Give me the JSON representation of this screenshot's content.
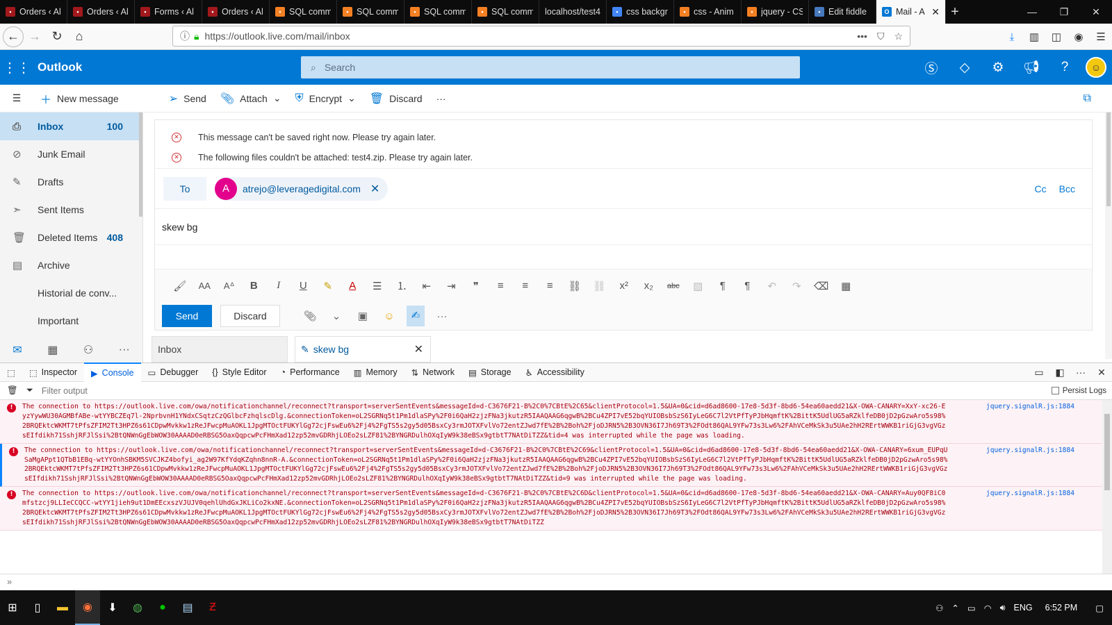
{
  "browser": {
    "tabs": [
      {
        "label": "Orders ‹ Al",
        "icon": "wp-icon",
        "color": "#a1191c"
      },
      {
        "label": "Orders ‹ Al",
        "icon": "wp-icon",
        "color": "#a1191c"
      },
      {
        "label": "Forms ‹ Al",
        "icon": "wp-icon",
        "color": "#a1191c"
      },
      {
        "label": "Orders ‹ Al",
        "icon": "wp-icon",
        "color": "#a1191c"
      },
      {
        "label": "SQL comm",
        "icon": "so-icon",
        "color": "#f48024"
      },
      {
        "label": "SQL comm",
        "icon": "so-icon",
        "color": "#f48024"
      },
      {
        "label": "SQL comm",
        "icon": "so-icon",
        "color": "#f48024"
      },
      {
        "label": "SQL comm",
        "icon": "so-icon",
        "color": "#f48024"
      },
      {
        "label": "localhost/test4",
        "icon": "",
        "color": ""
      },
      {
        "label": "css backgr",
        "icon": "google-icon",
        "color": "#4285f4"
      },
      {
        "label": "css - Anim",
        "icon": "so-icon",
        "color": "#f48024"
      },
      {
        "label": "jquery - CS",
        "icon": "so-icon",
        "color": "#f48024"
      },
      {
        "label": "Edit fiddle",
        "icon": "jsfiddle-icon",
        "color": "#4679bd"
      }
    ],
    "active_tab": {
      "label": "Mail - A",
      "icon": "outlook-icon",
      "color": "#0078d4"
    },
    "url": "https://outlook.live.com/mail/inbox"
  },
  "outlook": {
    "brand": "Outlook",
    "search_placeholder": "Search",
    "commands": {
      "new_message": "New message",
      "send": "Send",
      "attach": "Attach",
      "encrypt": "Encrypt",
      "discard": "Discard"
    },
    "folders": [
      {
        "label": "Inbox",
        "count": "100",
        "icon": "inbox-icon"
      },
      {
        "label": "Junk Email",
        "count": "",
        "icon": "junk-icon"
      },
      {
        "label": "Drafts",
        "count": "",
        "icon": "pencil-icon"
      },
      {
        "label": "Sent Items",
        "count": "",
        "icon": "sent-icon"
      },
      {
        "label": "Deleted Items",
        "count": "408",
        "icon": "trash-icon"
      },
      {
        "label": "Archive",
        "count": "",
        "icon": "archive-icon"
      },
      {
        "label": "Historial de conv...",
        "count": "",
        "icon": ""
      },
      {
        "label": "Important",
        "count": "",
        "icon": ""
      }
    ],
    "compose": {
      "errors": [
        "This message can't be saved right now. Please try again later.",
        "The following files couldn't be attached: test4.zip. Please try again later."
      ],
      "to_label": "To",
      "recipient_initial": "A",
      "recipient": "atrejo@leveragedigital.com",
      "cc": "Cc",
      "bcc": "Bcc",
      "subject": "skew bg",
      "send": "Send",
      "discard": "Discard"
    },
    "bottom_tabs": {
      "inbox": "Inbox",
      "draft": "skew bg"
    },
    "accent": "#0078d4"
  },
  "devtools": {
    "tabs": [
      "Inspector",
      "Console",
      "Debugger",
      "Style Editor",
      "Performance",
      "Memory",
      "Network",
      "Storage",
      "Accessibility"
    ],
    "active_tab": "Console",
    "filter_placeholder": "Filter output",
    "persist_logs": "Persist Logs",
    "messages": [
      {
        "text": "The connection to https://outlook.live.com/owa/notificationchannel/reconnect?transport=serverSentEvents&messageId=d-C3676F21-B%2C0%7CBtE%2C65&clientProtocol=1.5&UA=0&cid=d6ad8600-17e8-5d3f-8bd6-54ea60aedd21&X-OWA-CANARY=XxY-xc26-EyzYywWU30AGMBfABe-wtYYBCZEq7l-2NprbvnH1YNdxCSqtzCzQGlbcFzhqlscDlg.&connectionToken=oL2SGRNq5t1Pm1dlaSPy%2F0i6QaH2zjzFNa3jkutzR5IAAQAAG6qgwB%2BCu4ZPI7vE52bqYUIOBsbSzS6IyLeG6C7l2VtPfTyPJbHqmftK%2BittK5UdlUG5aRZklfeDB0jD2pGzwAro5s98%2BRQEktcWKMT7tPfsZFIM2Tt3HPZ6s61CDpwMvkkw1zReJFwcpMuAOKL1JpgMTOctFUKYlGg72cjFswEu6%2Fj4%2FgTS5s2gy5d05BsxCy3rmJOTXFvlVo72entZJwd7fE%2B%2Boh%2FjoDJRN5%2B3OVN36I7Jh69T3%2FOdt86QAL9YFw73s3Lw6%2FAhVCeMkSk3u5UAe2hH2RErtWWKB1riGjG3vgVGzsEIfdikh71SshjRFJlSsi%2BtQNWnGgEbWOW30AAAAD0eRBSG5OaxQqpcwPcFHmXad12zp52mvGDRhjLOEo2sLZF81%2BYNGRDulhOXqIyW9k38eBSx9gtbtT7NAtDiTZZ&tid=4 was interrupted while the page was loading.",
        "source": "jquery.signalR.js:1884"
      },
      {
        "text": "The connection to https://outlook.live.com/owa/notificationchannel/reconnect?transport=serverSentEvents&messageId=d-C3676F21-B%2C0%7CBtE%2C69&clientProtocol=1.5&UA=0&cid=d6ad8600-17e8-5d3f-8bd6-54ea60aedd21&X-OWA-CANARY=6xum_EUPqUSaMgAPpt1QTbB1EBq-wtYYOnhSBKM5SVCJKZ4bofyi_ag2W97KfYdqKZqhn8nnR-A.&connectionToken=oL2SGRNq5t1Pm1dlaSPy%2F0i6QaH2zjzFNa3jkutzR5IAAQAAG6qgwB%2BCu4ZPI7vE52bqYUIOBsbSzS6IyLeG6C7l2VtPfTyPJbHqmftK%2BittK5UdlUG5aRZklfeDB0jD2pGzwAro5s98%2BRQEktcWKMT7tPfsZFIM2Tt3HPZ6s61CDpwMvkkw1zReJFwcpMuAOKL1JpgMTOctFUKYlGg72cjFswEu6%2Fj4%2FgTS5s2gy5d05BsxCy3rmJOTXFvlVo72entZJwd7fE%2B%2Boh%2FjoDJRN5%2B3OVN36I7Jh69T3%2FOdt86QAL9YFw73s3Lw6%2FAhVCeMkSk3u5UAe2hH2RErtWWKB1riGjG3vgVGzsEIfdikh71SshjRFJlSsi%2BtQNWnGgEbWOW30AAAAD0eRBSG5OaxQqpcwPcFHmXad12zp52mvGDRhjLOEo2sLZF81%2BYNGRDulhOXqIyW9k38eBSx9gtbtT7NAtDiTZZ&tid=9 was interrupted while the page was loading.",
        "source": "jquery.signalR.js:1884"
      },
      {
        "text": "The connection to https://outlook.live.com/owa/notificationchannel/reconnect?transport=serverSentEvents&messageId=d-C3676F21-B%2C0%7CBtE%2C6D&clientProtocol=1.5&UA=0&cid=d6ad8600-17e8-5d3f-8bd6-54ea60aedd21&X-OWA-CANARY=Auy0QF8iC0mfstzcj9LLIeCCQCC-wtYY1jieh9ut1DmEEcxszVJUJV0qehlUhdGxJKLiCo2kxNE.&connectionToken=oL2SGRNq5t1Pm1dlaSPy%2F0i6QaH2zjzFNa3jkutzR5IAAQAAG6qgwB%2BCu4ZPI7vE52bqYUIOBsbSzS6IyLeG6C7l2VtPfTyPJbHqmftK%2BittK5UdlUG5aRZklfeDB0jD2pGzwAro5s98%2BRQEktcWKMT7tPfsZFIM2Tt3HPZ6s61CDpwMvkkw1zReJFwcpMuAOKL1JpgMTOctFUKYlGg72cjFswEu6%2Fj4%2FgTS5s2gy5d05BsxCy3rmJOTXFvlVo72entZJwd7fE%2B%2Boh%2FjoDJRN5%2B3OVN36I7Jh69T3%2FOdt86QAL9YFw73s3Lw6%2FAhVCeMkSk3u5UAe2hH2RErtWWKB1riGjG3vgVGzsEIfdikh71SshjRFJlSsi%2BtQNWnGgEbWOW30AAAAD0eRBSG5OaxQqpcwPcFHmXad12zp52mvGDRhjLOEo2sLZF81%2BYNGRDulhOXqIyW9k38eBSx9gtbtT7NAtDiTZZ",
        "source": "jquery.signalR.js:1884"
      }
    ],
    "prompt": "»"
  },
  "taskbar": {
    "lang": "ENG",
    "time": "6:52 PM"
  }
}
